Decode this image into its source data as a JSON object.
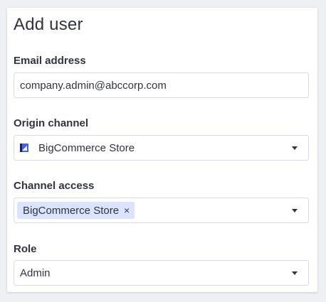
{
  "form": {
    "title": "Add user",
    "email": {
      "label": "Email address",
      "value": "company.admin@abccorp.com"
    },
    "origin_channel": {
      "label": "Origin channel",
      "value": "BigCommerce Store",
      "icon": "bigcommerce-store-icon"
    },
    "channel_access": {
      "label": "Channel access",
      "chips": [
        {
          "label": "BigCommerce Store"
        }
      ]
    },
    "role": {
      "label": "Role",
      "value": "Admin"
    }
  },
  "icons": {
    "remove": "×",
    "dropdown": "chevron-down-icon"
  },
  "colors": {
    "accent": "#3c64f4",
    "chip_background": "#dbe3fe",
    "border": "#d9dce9",
    "text": "#313440"
  }
}
